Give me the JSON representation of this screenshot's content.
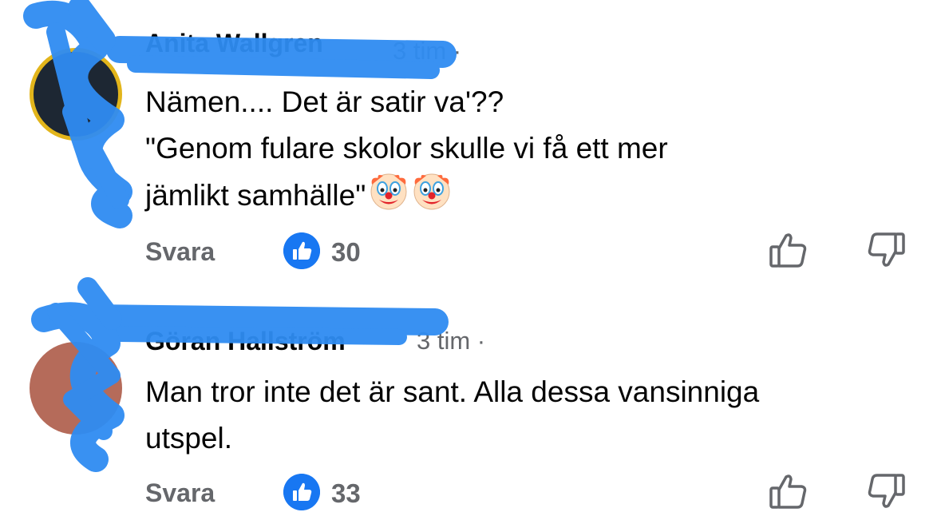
{
  "comments": [
    {
      "author": "Anita Wallgren",
      "time": "3 tim ·",
      "lines": [
        "Nämen.... Det är satir va'??",
        "\"Genom fulare skolor skulle vi få ett mer",
        "jämlikt samhälle\""
      ],
      "emoji": [
        "clown-face",
        "clown-face"
      ],
      "reply_label": "Svara",
      "like_count": "30"
    },
    {
      "author": "Göran Hallström",
      "time": "3 tim ·",
      "lines": [
        "Man tror inte det är sant. Alla dessa vansinniga",
        "utspel."
      ],
      "reply_label": "Svara",
      "like_count": "33"
    }
  ],
  "icons": {
    "like_badge": "thumbs-up-filled-icon",
    "like_button": "thumbs-up-outline-icon",
    "dislike_button": "thumbs-down-outline-icon"
  },
  "colors": {
    "like_blue": "#1877f2",
    "secondary_text": "#65676b",
    "redaction_blue": "#2f8cf2"
  }
}
